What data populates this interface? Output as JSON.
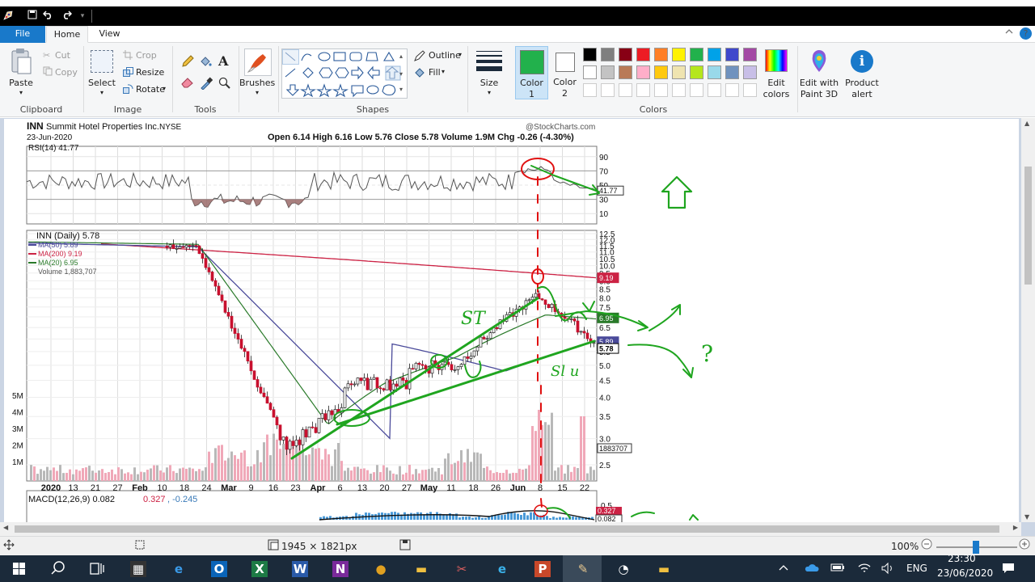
{
  "window": {
    "quick_access": [
      "save-icon",
      "undo-icon",
      "redo-icon"
    ]
  },
  "tabs": {
    "file": "File",
    "home": "Home",
    "view": "View"
  },
  "ribbon": {
    "clipboard": {
      "label": "Clipboard",
      "paste": "Paste",
      "cut": "Cut",
      "copy": "Copy"
    },
    "image": {
      "label": "Image",
      "select": "Select",
      "crop": "Crop",
      "resize": "Resize",
      "rotate": "Rotate"
    },
    "tools": {
      "label": "Tools"
    },
    "brushes": {
      "label": "Brushes"
    },
    "shapes": {
      "label": "Shapes",
      "outline": "Outline",
      "fill": "Fill"
    },
    "size": {
      "label": "Size"
    },
    "color1": {
      "label": "Color",
      "num": "1"
    },
    "color2": {
      "label": "Color",
      "num": "2"
    },
    "colors": {
      "label": "Colors",
      "edit": "Edit",
      "edit2": "colors",
      "row1": [
        "#000000",
        "#7f7f7f",
        "#880015",
        "#ed1c24",
        "#ff7f27",
        "#fff200",
        "#22b14c",
        "#00a2e8",
        "#3f48cc",
        "#a349a4"
      ],
      "row2": [
        "#ffffff",
        "#c3c3c3",
        "#b97a57",
        "#ffaec9",
        "#ffc90e",
        "#efe4b0",
        "#b5e61d",
        "#99d9ea",
        "#7092be",
        "#c8bfe7"
      ]
    },
    "paint3d": {
      "l1": "Edit with",
      "l2": "Paint 3D"
    },
    "product_alert": {
      "l1": "Product",
      "l2": "alert"
    }
  },
  "chart": {
    "ticker": "INN",
    "company": "Summit Hotel Properties Inc.",
    "exchange": "NYSE",
    "date": "23-Jun-2020",
    "source": "@StockCharts.com",
    "ohlc": "Open 6.14  High 6.16  Low 5.76  Close 5.78  Volume 1.9M  Chg -0.26 (-4.30%)",
    "rsi_label": "RSI(14) 41.77",
    "rsi_ticks": [
      "90",
      "70",
      "50",
      "30",
      "10"
    ],
    "rsi_value": "41.77",
    "legend": {
      "inn": "INN (Daily) 5.78",
      "ma50": "MA(50) 5.89",
      "ma200": "MA(200) 9.19",
      "ma20": "MA(20) 6.95",
      "volume": "Volume 1,883,707"
    },
    "price_ticks": [
      "12.5",
      "12.0",
      "11.5",
      "11.0",
      "10.5",
      "10.0",
      "9.5",
      "9.0",
      "8.5",
      "8.0",
      "7.5",
      "7.0",
      "6.5",
      "6.0",
      "5.5",
      "5.0",
      "4.5",
      "4.0",
      "3.5",
      "3.0",
      "2.5"
    ],
    "price_tags": {
      "ma200": "9.19",
      "ma20": "6.95",
      "close": "5.78",
      "ma50": "5.89"
    },
    "volume_ticks": [
      "5M",
      "4M",
      "3M",
      "2M",
      "1M"
    ],
    "volume_tag": "1883707",
    "x_labels": [
      "2020",
      "13",
      "21",
      "27",
      "Feb",
      "10",
      "18",
      "24",
      "Mar",
      "9",
      "16",
      "23",
      "Apr",
      "6",
      "13",
      "20",
      "27",
      "May",
      "11",
      "18",
      "26",
      "Jun",
      "8",
      "15",
      "22"
    ],
    "macd_label": "MACD(12,26,9)",
    "macd_values": {
      "macd": "0.082",
      "signal": "0.327",
      "hist": "-0.245"
    },
    "macd_tags": {
      "signal": "0.327",
      "macd": "0.082"
    },
    "macd_tick": "0.5",
    "colors": {
      "ma50": "#4a4a9a",
      "ma200": "#cc2244",
      "ma20": "#2a7a2a",
      "annotation_green": "#1fa51f",
      "annotation_red": "#e01010"
    }
  },
  "annotations": {
    "st": "ST",
    "sl": "Sl u",
    "question": "?"
  },
  "status": {
    "dimensions": "1945 × 1821px",
    "zoom": "100%"
  },
  "taskbar": {
    "apps": [
      "calculator-icon",
      "edge-icon",
      "outlook-icon",
      "excel-icon",
      "word-icon",
      "onenote-icon",
      "chrome-icon",
      "file-explorer-icon",
      "snipping-icon",
      "edge-new-icon",
      "powerpoint-icon",
      "paint-icon",
      "clock-app-icon",
      "folder-icon"
    ],
    "lang": "ENG",
    "time": "23:30",
    "date": "23/06/2020"
  }
}
